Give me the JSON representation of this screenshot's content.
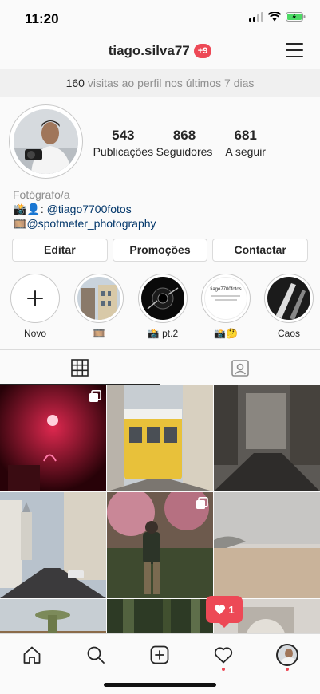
{
  "status_bar": {
    "time": "11:20"
  },
  "header": {
    "username": "tiago.silva77",
    "notifications": "+9"
  },
  "visits": {
    "count": "160",
    "text": " visitas ao perfil nos últimos 7 dias"
  },
  "stats": [
    {
      "num": "543",
      "label": "Publicações"
    },
    {
      "num": "868",
      "label": "Seguidores"
    },
    {
      "num": "681",
      "label": "A seguir"
    }
  ],
  "bio": {
    "category": "Fotógrafo/a",
    "line1_prefix": "📸👤: ",
    "line1_link": "@tiago7700fotos",
    "line2_prefix": "🎞️",
    "line2_link": "@spotmeter_photography"
  },
  "buttons": {
    "edit": "Editar",
    "promotions": "Promoções",
    "contact": "Contactar"
  },
  "highlights": [
    {
      "label": "Novo"
    },
    {
      "label": "🎞️"
    },
    {
      "label": "📸 pt.2"
    },
    {
      "label": "📸🤔",
      "inner_text": "tiago7700fotos"
    },
    {
      "label": "Caos"
    }
  ],
  "likes_popup": {
    "count": "1"
  },
  "colors": {
    "accent_red": "#ed4956",
    "link": "#003569",
    "text": "#262626",
    "muted": "#8e8e8e"
  }
}
